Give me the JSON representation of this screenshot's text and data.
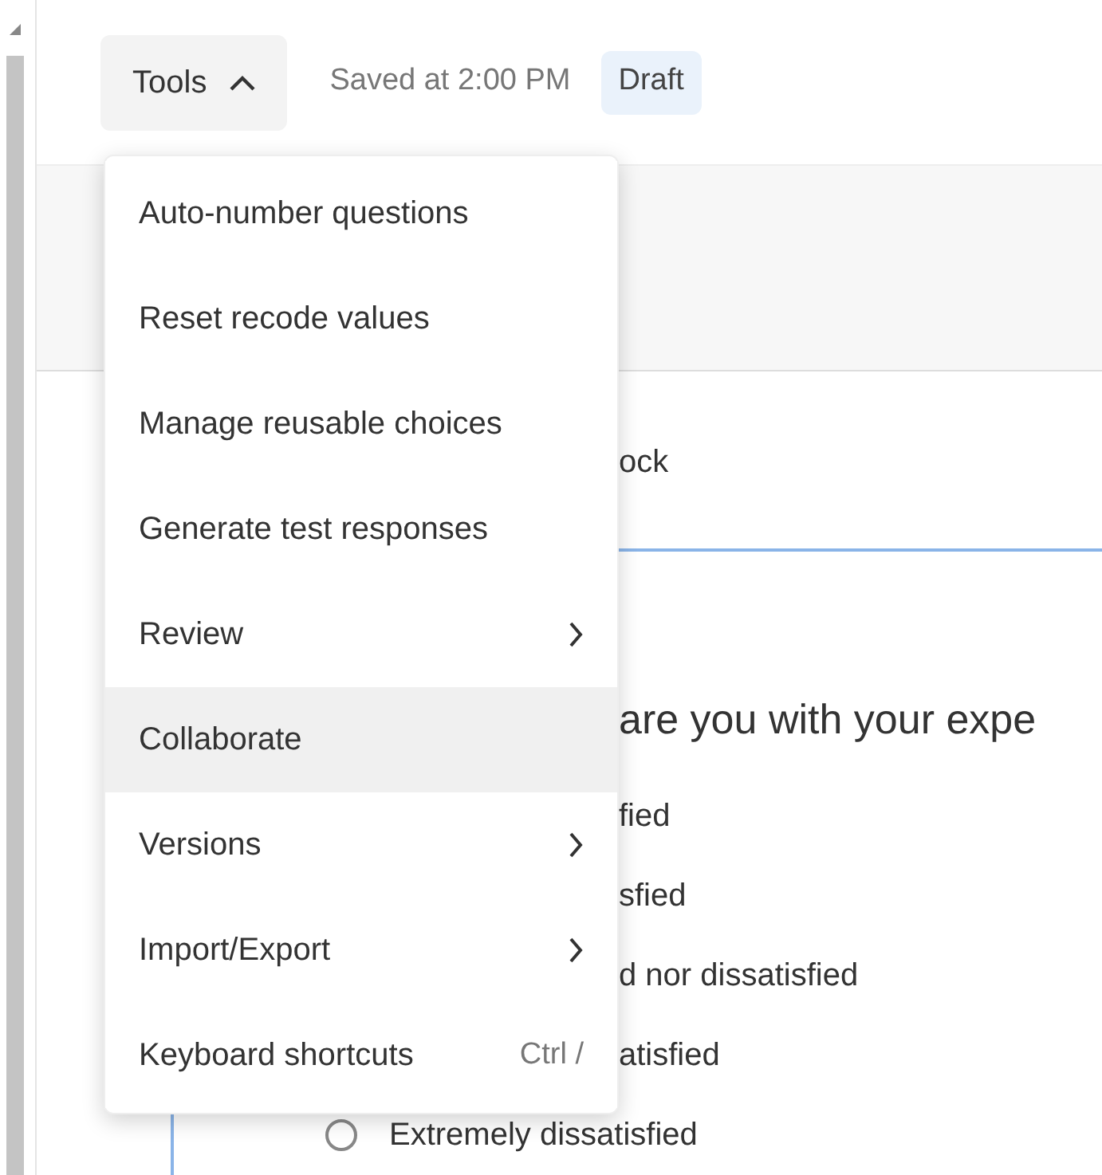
{
  "toolbar": {
    "tools_button": {
      "label": "Tools",
      "expanded": true
    },
    "saved_status": "Saved at 2:00 PM",
    "badge": "Draft"
  },
  "tools_menu": {
    "items": [
      {
        "label": "Auto-number questions",
        "selected": false,
        "has_submenu": false
      },
      {
        "label": "Reset recode values",
        "selected": false,
        "has_submenu": false
      },
      {
        "label": "Manage reusable choices",
        "selected": false,
        "has_submenu": false
      },
      {
        "label": "Generate test responses",
        "selected": false,
        "has_submenu": false
      },
      {
        "label": "Review",
        "selected": false,
        "has_submenu": true
      },
      {
        "label": "Collaborate",
        "selected": true,
        "has_submenu": false
      },
      {
        "label": "Versions",
        "selected": false,
        "has_submenu": true
      },
      {
        "label": "Import/Export",
        "selected": false,
        "has_submenu": true
      },
      {
        "label": "Keyboard shortcuts",
        "selected": false,
        "has_submenu": false,
        "shortcut": "Ctrl /"
      }
    ]
  },
  "survey": {
    "block_title": "ock",
    "question": "are you with your expe",
    "choices": [
      {
        "label": "fied",
        "kind": "fragment"
      },
      {
        "label": "sfied",
        "kind": "fragment"
      },
      {
        "label": "d nor dissatisfied",
        "kind": "fragment"
      },
      {
        "label": "atisfied",
        "kind": "fragment"
      },
      {
        "label": "Extremely dissatisfied",
        "kind": "radio",
        "selected": false
      }
    ]
  }
}
